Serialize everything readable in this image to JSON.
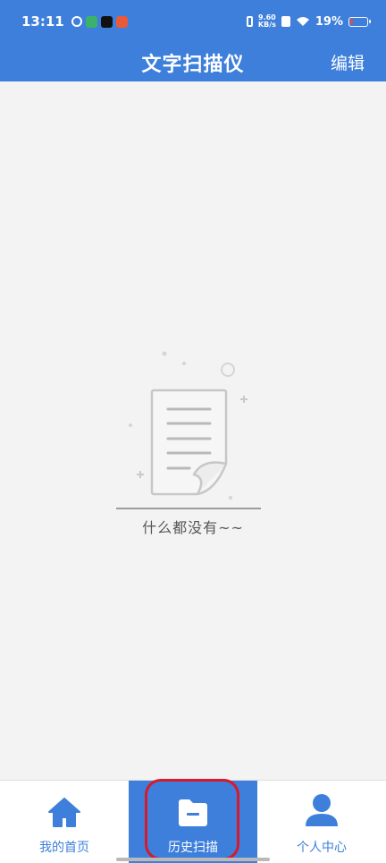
{
  "status_bar": {
    "time": "13:11",
    "net_speed_value": "9.60",
    "net_speed_unit": "KB/s",
    "battery": "19%"
  },
  "header": {
    "title": "文字扫描仪",
    "edit_label": "编辑"
  },
  "empty_state": {
    "message": "什么都没有~~",
    "icon": "document-icon"
  },
  "bottom_nav": {
    "items": [
      {
        "label": "我的首页",
        "icon": "home-icon",
        "active": false
      },
      {
        "label": "历史扫描",
        "icon": "folder-icon",
        "active": true
      },
      {
        "label": "个人中心",
        "icon": "person-icon",
        "active": false
      }
    ]
  },
  "colors": {
    "primary": "#3d7fdb",
    "background": "#f3f3f3",
    "highlight": "#d8192b"
  }
}
